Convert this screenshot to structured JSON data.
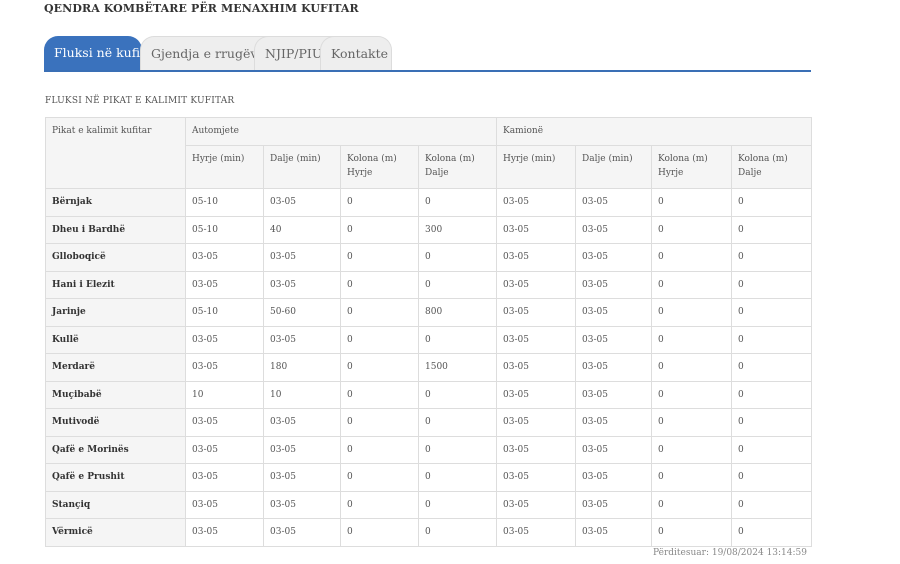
{
  "header": {
    "title": "QENDRA KOMBËTARE PËR MENAXHIM KUFITAR"
  },
  "tabs": [
    {
      "label": "Fluksi në kufi",
      "active": true
    },
    {
      "label": "Gjendja e rrugëve",
      "active": false
    },
    {
      "label": "NJIP/PIU",
      "active": false
    },
    {
      "label": "Kontakte",
      "active": false
    }
  ],
  "section": {
    "title": "FLUKSI NË PIKAT E KALIMIT KUFITAR"
  },
  "table": {
    "first_col_header": "Pikat e kalimit kufitar",
    "group_headers": [
      "Automjete",
      "Kamionë"
    ],
    "sub_headers": [
      "Hyrje (min)",
      "Dalje (min)",
      "Kolona (m) Hyrje",
      "Kolona (m) Dalje",
      "Hyrje (min)",
      "Dalje (min)",
      "Kolona (m) Hyrje",
      "Kolona (m) Dalje"
    ],
    "rows": [
      [
        "Bërnjak",
        "05-10",
        "03-05",
        "0",
        "0",
        "03-05",
        "03-05",
        "0",
        "0"
      ],
      [
        "Dheu i Bardhë",
        "05-10",
        "40",
        "0",
        "300",
        "03-05",
        "03-05",
        "0",
        "0"
      ],
      [
        "Glloboqicë",
        "03-05",
        "03-05",
        "0",
        "0",
        "03-05",
        "03-05",
        "0",
        "0"
      ],
      [
        "Hani i Elezit",
        "03-05",
        "03-05",
        "0",
        "0",
        "03-05",
        "03-05",
        "0",
        "0"
      ],
      [
        "Jarinje",
        "05-10",
        "50-60",
        "0",
        "800",
        "03-05",
        "03-05",
        "0",
        "0"
      ],
      [
        "Kullë",
        "03-05",
        "03-05",
        "0",
        "0",
        "03-05",
        "03-05",
        "0",
        "0"
      ],
      [
        "Merdarë",
        "03-05",
        "180",
        "0",
        "1500",
        "03-05",
        "03-05",
        "0",
        "0"
      ],
      [
        "Muçibabë",
        "10",
        "10",
        "0",
        "0",
        "03-05",
        "03-05",
        "0",
        "0"
      ],
      [
        "Mutivodë",
        "03-05",
        "03-05",
        "0",
        "0",
        "03-05",
        "03-05",
        "0",
        "0"
      ],
      [
        "Qafë e Morinës",
        "03-05",
        "03-05",
        "0",
        "0",
        "03-05",
        "03-05",
        "0",
        "0"
      ],
      [
        "Qafë e Prushit",
        "03-05",
        "03-05",
        "0",
        "0",
        "03-05",
        "03-05",
        "0",
        "0"
      ],
      [
        "Stançiq",
        "03-05",
        "03-05",
        "0",
        "0",
        "03-05",
        "03-05",
        "0",
        "0"
      ],
      [
        "Vërmicë",
        "03-05",
        "03-05",
        "0",
        "0",
        "03-05",
        "03-05",
        "0",
        "0"
      ]
    ]
  },
  "footer": {
    "updated": "Përditesuar: 19/08/2024 13:14:59"
  },
  "colors": {
    "accent": "#3a72bd",
    "tab_inactive": "#eeeeee",
    "header_bg": "#f5f5f5",
    "border": "#dddddd"
  }
}
